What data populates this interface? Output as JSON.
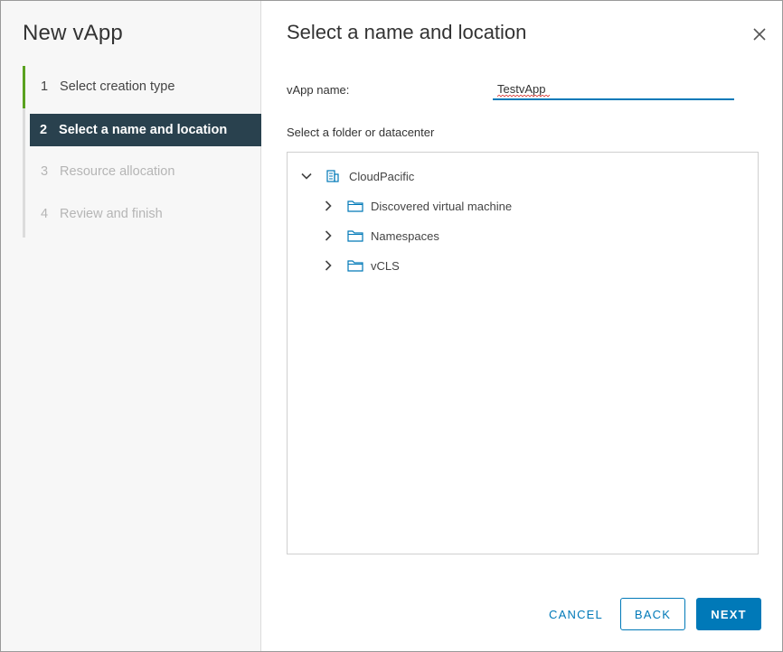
{
  "wizard": {
    "title": "New vApp",
    "steps": [
      {
        "number": "1",
        "label": "Select creation type",
        "state": "done"
      },
      {
        "number": "2",
        "label": "Select a name and location",
        "state": "active"
      },
      {
        "number": "3",
        "label": "Resource allocation",
        "state": "disabled"
      },
      {
        "number": "4",
        "label": "Review and finish",
        "state": "disabled"
      }
    ]
  },
  "content": {
    "title": "Select a name and location",
    "vapp_name_label": "vApp name:",
    "vapp_name_value": "TestvApp",
    "folder_label": "Select a folder or datacenter"
  },
  "tree": {
    "root": {
      "label": "CloudPacific",
      "icon": "datacenter-icon",
      "expanded": true
    },
    "children": [
      {
        "label": "Discovered virtual machine",
        "icon": "folder-icon",
        "expanded": false
      },
      {
        "label": "Namespaces",
        "icon": "folder-icon",
        "expanded": false
      },
      {
        "label": "vCLS",
        "icon": "folder-icon",
        "expanded": false
      }
    ]
  },
  "footer": {
    "cancel": "CANCEL",
    "back": "BACK",
    "next": "NEXT"
  },
  "colors": {
    "accent": "#0079b8",
    "active_step_bg": "#29414e",
    "completed_step": "#5aa220",
    "disabled_text": "#b5b5b5"
  }
}
